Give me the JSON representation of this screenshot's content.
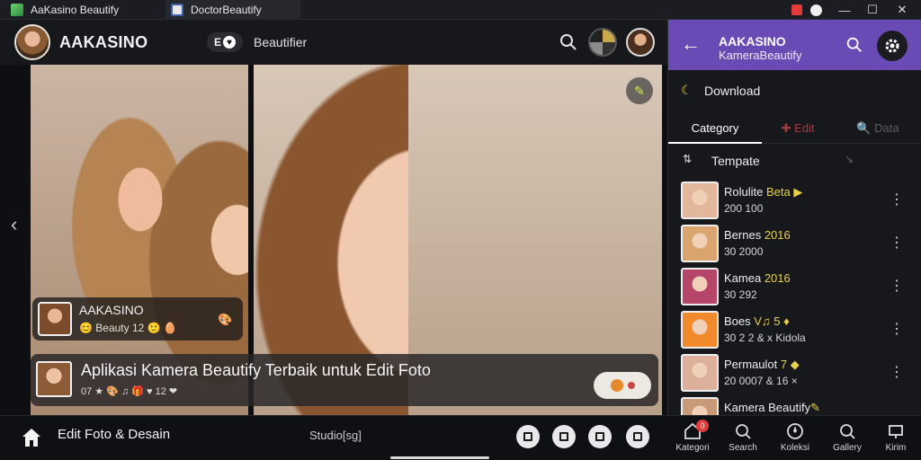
{
  "window": {
    "tabs": [
      {
        "label": "AaKasino Beautify"
      },
      {
        "label": "DoctorBeautify"
      }
    ],
    "controls": {
      "minimize": "—",
      "maximize": "☐",
      "close": "✕"
    }
  },
  "header": {
    "brand": "AAKASINO",
    "badge": "E",
    "label": "Beautifier"
  },
  "stage": {
    "nav_left": "‹",
    "user_card": {
      "name": "AAKASINO",
      "meta": "😊 Beauty 12 🙂 🥚",
      "more": "🎨"
    },
    "caption": {
      "title": "Aplikasi Kamera Beautify Terbaik untuk Edit Foto",
      "meta": "07 ★ 🎨 ♫ 🎁 ♥ 12 ❤"
    }
  },
  "panel": {
    "title": "AAKASINO",
    "subtitle": "KameraBeautify",
    "filter_label": "Download",
    "tabs": [
      {
        "label": "Category"
      },
      {
        "label": "✚ Edit"
      },
      {
        "label": "🔍 Data"
      }
    ],
    "sort_label": "Tempate",
    "tracks": [
      {
        "title": "Rolulite ",
        "tag": "Beta ▶",
        "sub": "200 100",
        "thumb": "#e3b79b"
      },
      {
        "title": "Bernes ",
        "tag": "2016",
        "sub": "30 2000",
        "thumb": "#d9a46e"
      },
      {
        "title": "Kamea ",
        "tag": "2016",
        "sub": "30 292",
        "thumb": "#b6456a"
      },
      {
        "title": "Boes ",
        "tag": "V♫ 5 ♦",
        "sub": "30 2 2 & x Kidola",
        "thumb": "#f08a2c"
      },
      {
        "title": "Permaulot ",
        "tag": "7 ◆",
        "sub": "20 0007 & 16 ×",
        "thumb": "#dcb09a"
      },
      {
        "title": "Kamera Beautify",
        "tag": "✎",
        "sub": "",
        "thumb": "#c99a78"
      }
    ]
  },
  "bottombar": {
    "title": "Edit Foto & Desain",
    "center": "Studio[sg]"
  },
  "panel_nav": {
    "badge": "0",
    "items": [
      {
        "label": "Kategori"
      },
      {
        "label": "Search"
      },
      {
        "label": "Koleksi"
      },
      {
        "label": "Gallery"
      },
      {
        "label": "Kirim"
      }
    ]
  }
}
